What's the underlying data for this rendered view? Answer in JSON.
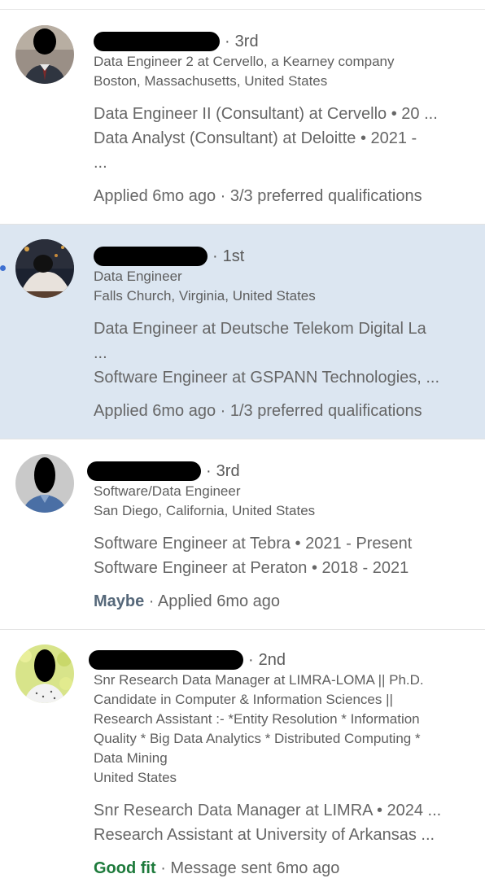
{
  "applicants": [
    {
      "degree": "3rd",
      "headline": "Data Engineer 2 at Cervello, a Kearney company",
      "location": "Boston, Massachusetts, United States",
      "experience": [
        "Data Engineer II (Consultant) at Cervello • 20 ...",
        "Data Analyst (Consultant) at Deloitte • 2021 -",
        "..."
      ],
      "status": "Applied 6mo ago · 3/3 preferred qualifications"
    },
    {
      "degree": "1st",
      "headline": "Data Engineer",
      "location": "Falls Church, Virginia, United States",
      "experience": [
        "Data Engineer at Deutsche Telekom Digital La",
        "...",
        "Software Engineer at GSPANN Technologies, ..."
      ],
      "status": "Applied 6mo ago · 1/3 preferred qualifications"
    },
    {
      "degree": "3rd",
      "headline": "Software/Data Engineer",
      "location": "San Diego, California, United States",
      "experience": [
        "Software Engineer at Tebra • 2021 - Present",
        "Software Engineer at Peraton • 2018 - 2021"
      ],
      "rating": "Maybe",
      "status": "Applied 6mo ago"
    },
    {
      "degree": "2nd",
      "headline_lines": [
        "Snr Research Data Manager at LIMRA-LOMA || Ph.D.",
        "Candidate in Computer & Information Sciences ||",
        "Research Assistant :- *Entity Resolution * Information",
        "Quality * Big Data Analytics * Distributed Computing *",
        "Data Mining"
      ],
      "location": "United States",
      "experience": [
        "Snr Research Data Manager at LIMRA • 2024 ...",
        "Research Assistant at University of Arkansas ..."
      ],
      "rating": "Good fit",
      "status": "Message sent 6mo ago"
    }
  ],
  "colors": {
    "selected_bg": "#dce6f1",
    "unread_dot": "#3d6fd1",
    "maybe": "#56687a",
    "good_fit": "#1d7a3b"
  }
}
